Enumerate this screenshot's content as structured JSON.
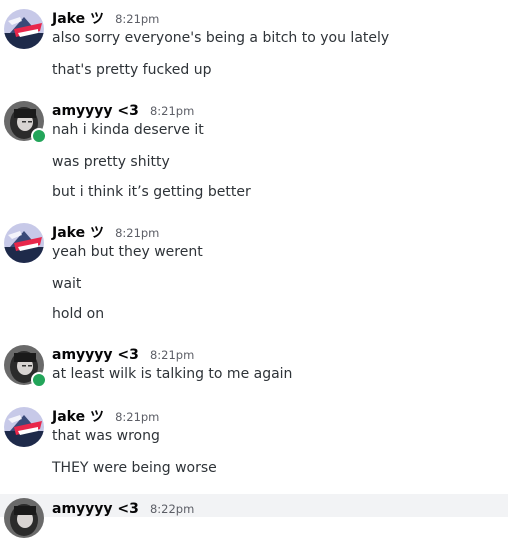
{
  "messages": [
    {
      "author": "Jake ツ",
      "time": "8:21pm",
      "avatar_icon": "jake-avatar",
      "online": false,
      "lines": [
        "also sorry everyone's being a bitch to you lately",
        "that's pretty fucked up"
      ]
    },
    {
      "author": "amyyyy <3",
      "time": "8:21pm",
      "avatar_icon": "amy-avatar",
      "online": true,
      "lines": [
        "nah i kinda deserve it",
        "was pretty shitty",
        "but i think it’s getting better"
      ]
    },
    {
      "author": "Jake ツ",
      "time": "8:21pm",
      "avatar_icon": "jake-avatar",
      "online": false,
      "lines": [
        "yeah but they werent",
        "wait",
        "hold on"
      ]
    },
    {
      "author": "amyyyy <3",
      "time": "8:21pm",
      "avatar_icon": "amy-avatar",
      "online": true,
      "lines": [
        "at least wilk is talking to me again"
      ]
    },
    {
      "author": "Jake ツ",
      "time": "8:21pm",
      "avatar_icon": "jake-avatar",
      "online": false,
      "lines": [
        "that was wrong",
        "THEY were being worse"
      ]
    },
    {
      "author": "amyyyy <3",
      "time": "8:22pm",
      "avatar_icon": "amy-avatar",
      "online": true,
      "lines": []
    }
  ],
  "colors": {
    "online": "#23a55a",
    "hover_background": "#f2f3f5"
  }
}
